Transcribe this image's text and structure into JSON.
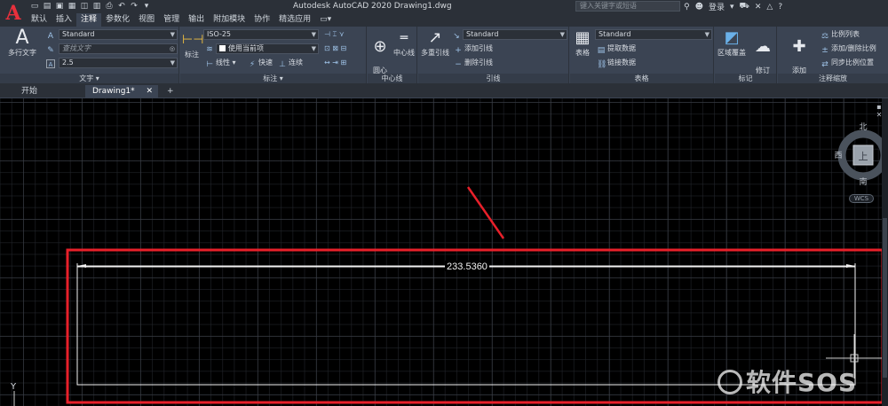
{
  "titlebar": {
    "app_letter": "A",
    "window_title": "Autodesk AutoCAD 2020    Drawing1.dwg",
    "search_placeholder": "键入关键字或短语",
    "login": "登录",
    "help": "?"
  },
  "menu": {
    "tabs": [
      "默认",
      "插入",
      "注释",
      "参数化",
      "视图",
      "管理",
      "输出",
      "附加模块",
      "协作",
      "精选应用"
    ],
    "active_index": 2
  },
  "ribbon": {
    "text_panel": {
      "label": "文字",
      "big_button": "多行文字",
      "style": "Standard",
      "find_placeholder": "查找文字",
      "height": "2.5"
    },
    "dim_panel": {
      "label": "标注",
      "big_button": "标注",
      "style": "ISO-25",
      "layer": "使用当前项",
      "linear": "线性",
      "quick": "快速",
      "continue": "连续"
    },
    "centerline_panel": {
      "label": "中心线",
      "center_mark": "圆心\n标记",
      "center_line": "中心线"
    },
    "leader_panel": {
      "label": "引线",
      "big_button": "多重引线",
      "style": "Standard",
      "add": "添加引线",
      "remove": "删除引线"
    },
    "table_panel": {
      "label": "表格",
      "big_button": "表格",
      "style": "Standard",
      "extract": "提取数据",
      "link": "链接数据"
    },
    "markup_panel": {
      "label": "标记",
      "wipeout": "区域覆盖",
      "revcloud": "修订\n云线"
    },
    "scale_panel": {
      "label": "注释缩放",
      "add_scale": "添加\n当前比例",
      "scale_list": "比例列表",
      "add_delete": "添加/删除比例",
      "sync": "同步比例位置"
    }
  },
  "doc_tabs": {
    "start": "开始",
    "drawing": "Drawing1*",
    "add": "+"
  },
  "drawing": {
    "dimension_text": "233.5360",
    "viewcube": {
      "north": "北",
      "south": "南",
      "west": "西",
      "top": "上"
    },
    "wcs": "WCS",
    "ucs_y": "Y",
    "highlight_color": "#e8202a",
    "dim_color": "#ffffff"
  },
  "watermark": "软件SOS"
}
